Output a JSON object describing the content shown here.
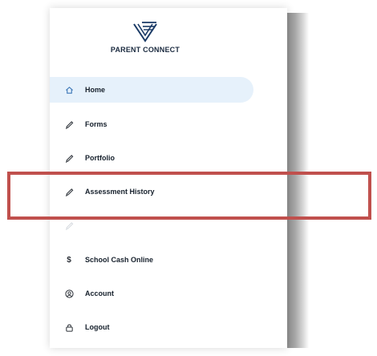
{
  "brand": {
    "title": "PARENT CONNECT",
    "icon": "parent-connect-logo",
    "color": "#1a3a66"
  },
  "nav": {
    "items": [
      {
        "label": "Home",
        "icon": "home-icon",
        "active": true
      },
      {
        "label": "Forms",
        "icon": "pen-icon"
      },
      {
        "label": "Portfolio",
        "icon": "pen-icon"
      },
      {
        "label": "Assessment History",
        "icon": "pen-icon"
      },
      {
        "label": "",
        "icon": "pen-icon"
      },
      {
        "label": "School Cash Online",
        "icon": "dollar-icon"
      },
      {
        "label": "Account",
        "icon": "account-icon"
      },
      {
        "label": "Logout",
        "icon": "lock-icon"
      }
    ]
  },
  "colors": {
    "active_bg": "#e6f1fb",
    "highlight_border": "#c0504d",
    "text": "#16202c"
  }
}
